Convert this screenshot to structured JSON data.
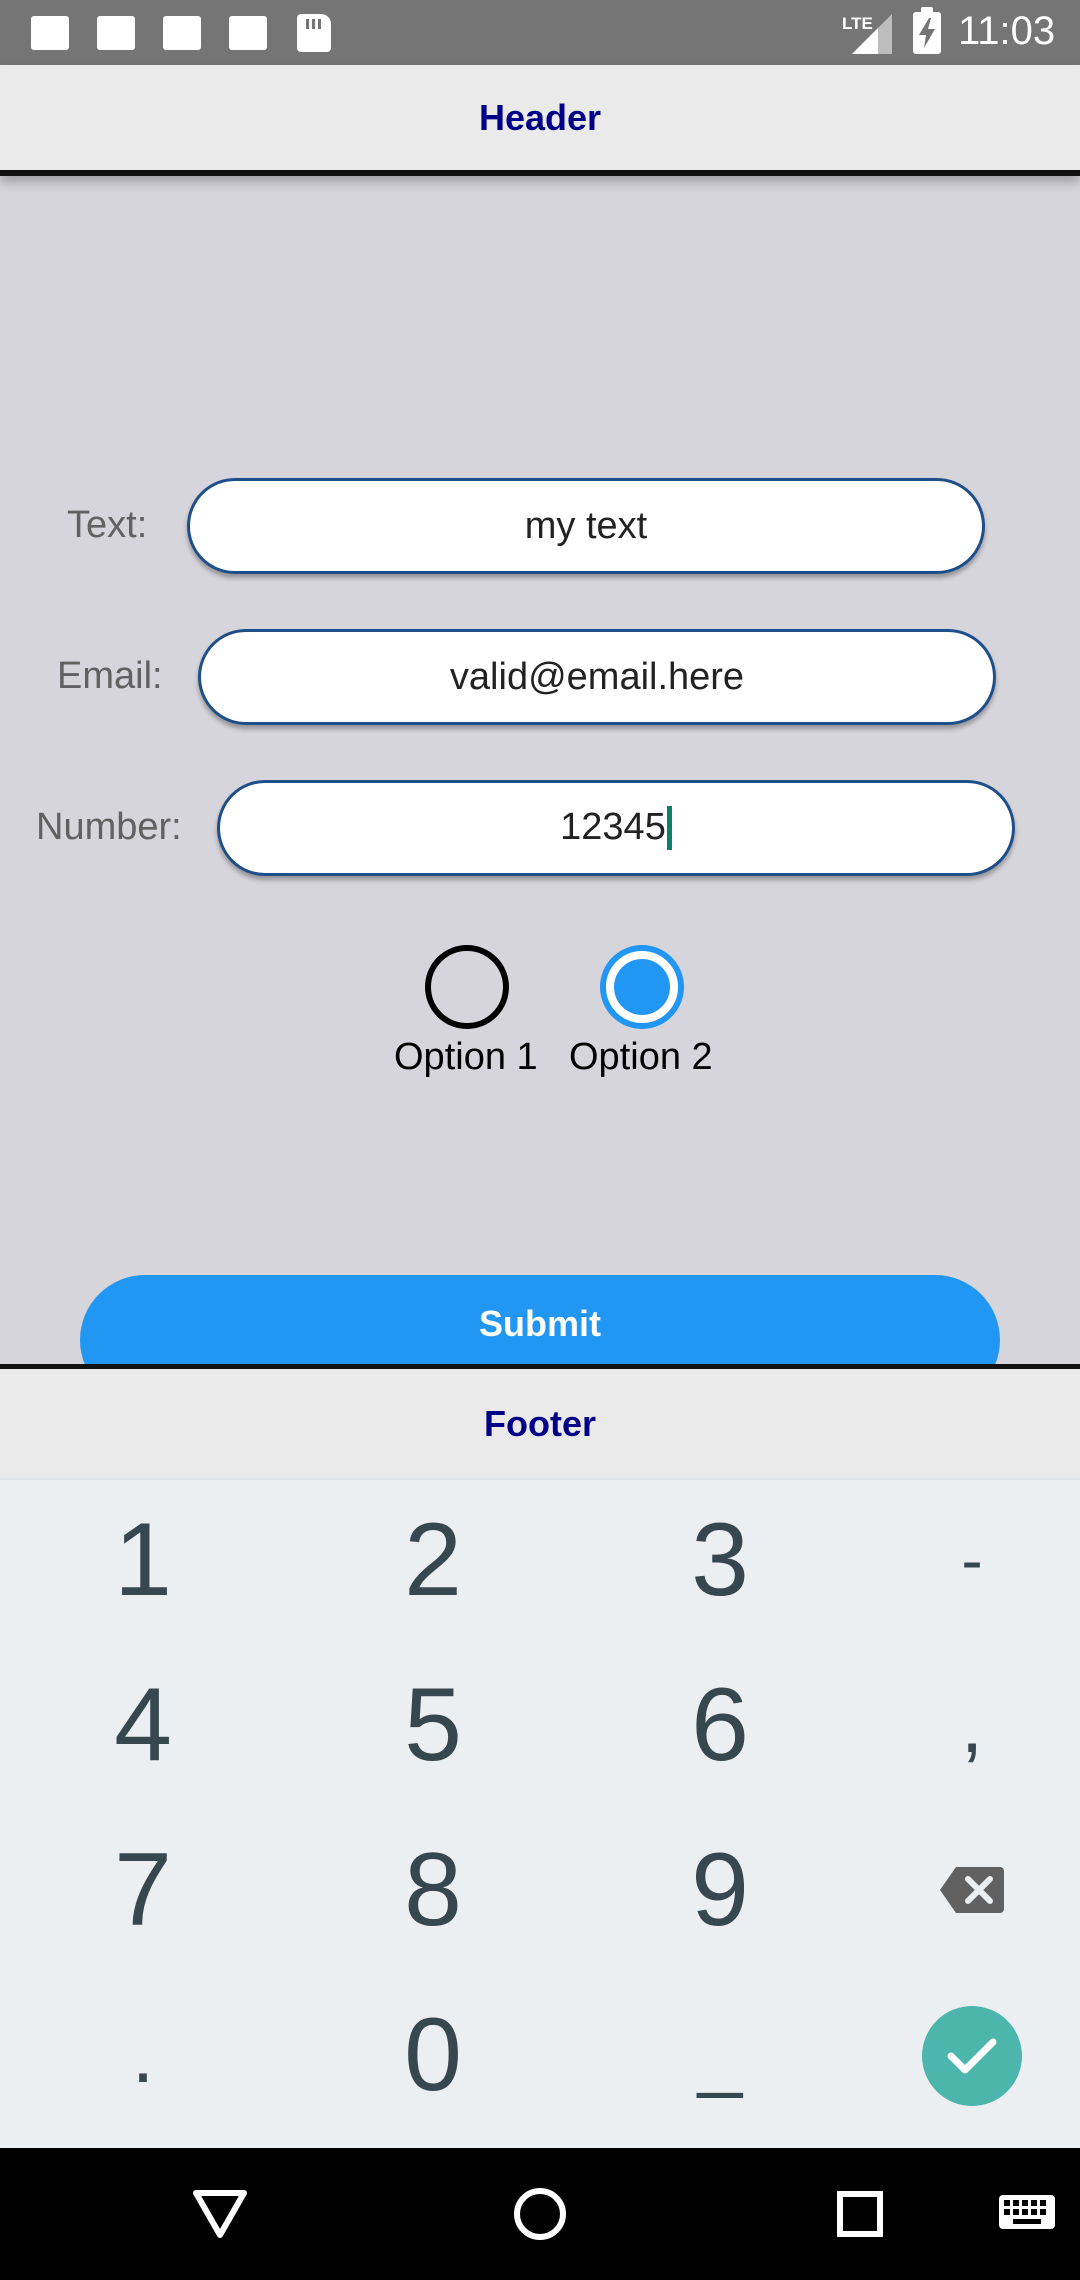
{
  "status_bar": {
    "network_label": "LTE",
    "time": "11:03"
  },
  "header": {
    "title": "Header"
  },
  "form": {
    "text_label": "Text:",
    "text_value": "my text",
    "email_label": "Email:",
    "email_value": "valid@email.here",
    "number_label": "Number:",
    "number_value": "12345",
    "radio_options": [
      {
        "label": "Option 1",
        "selected": false
      },
      {
        "label": "Option 2",
        "selected": true
      }
    ],
    "submit_label": "Submit"
  },
  "footer": {
    "title": "Footer"
  },
  "keyboard": {
    "keys": [
      "1",
      "2",
      "3",
      "-",
      "4",
      "5",
      "6",
      ",",
      "7",
      "8",
      "9",
      "backspace",
      ".",
      "0",
      "_",
      "enter"
    ]
  },
  "colors": {
    "accent": "#2196f3",
    "header_text": "#000088",
    "enter_key": "#4db6ac",
    "field_border": "#1e4f8a"
  },
  "nav_bar": {
    "icons": [
      "back-icon",
      "home-icon",
      "recents-icon",
      "keyboard-icon"
    ]
  }
}
